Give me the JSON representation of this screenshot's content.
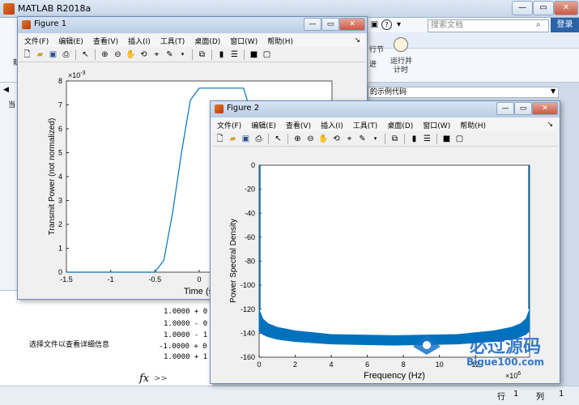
{
  "main_window": {
    "title": "MATLAB R2018a",
    "search_placeholder": "搜索文档",
    "login_label": "登录",
    "ribbon_run_section": "运行并\n计时",
    "ribbon_run_label_1": "运行并",
    "ribbon_run_label_2": "计时",
    "ribbon_section_label": "行节",
    "ribbon_advance_label": "进",
    "ribbon_new_label": "新",
    "example_bar_text": "的示例代码",
    "left_label_1": "当",
    "left_label_2": "详",
    "details_text": "选择文件以查看详细信息",
    "cmd_lines": [
      "1.0000 + 0",
      "1.0000 - 0",
      "1.0000 - 1",
      "-1.0000 + 0",
      "1.0000 + 1"
    ],
    "prompt": ">>",
    "fx": "fx",
    "status": {
      "row_label": "行",
      "row_value": "1",
      "col_label": "列",
      "col_value": "1"
    }
  },
  "menus": [
    "文件(F)",
    "编辑(E)",
    "查看(V)",
    "插入(I)",
    "工具(T)",
    "桌面(D)",
    "窗口(W)",
    "帮助(H)"
  ],
  "figure1": {
    "title": "Figure 1",
    "ylabel": "Transmit Power (not normalized)",
    "xlabel": "Time (s",
    "exponent": "×10",
    "exponent_power": "-3"
  },
  "figure2": {
    "title": "Figure 2",
    "ylabel": "Power Spectral Density",
    "xlabel": "Frequency (Hz)",
    "exponent": "×10",
    "exponent_power": "6"
  },
  "watermark": {
    "line1": "必过源码",
    "line2": "Bigue100.com"
  },
  "chart_data": [
    {
      "type": "line",
      "title": "",
      "xlabel": "Time (s",
      "ylabel": "Transmit Power (not normalized)",
      "xlim": [
        -1.5,
        1.5
      ],
      "ylim": [
        0,
        8
      ],
      "y_scale_exponent": -3,
      "x_ticks": [
        "-1.5",
        "-1",
        "-0.5",
        "0",
        "0.5"
      ],
      "y_ticks": [
        "0",
        "1",
        "2",
        "3",
        "4",
        "5",
        "6",
        "7",
        "8"
      ],
      "series": [
        {
          "x": [
            -1.5,
            -0.5,
            -0.4,
            -0.3,
            -0.2,
            -0.1,
            0.0,
            0.1,
            0.3,
            0.5,
            0.6,
            0.7
          ],
          "y": [
            0,
            0,
            0.5,
            2.5,
            5.0,
            7.2,
            7.7,
            7.7,
            7.7,
            7.7,
            6.5,
            3.0
          ]
        }
      ],
      "color": "#0072bd"
    },
    {
      "type": "area",
      "title": "",
      "xlabel": "Frequency (Hz)",
      "ylabel": "Power Spectral Density",
      "xlim": [
        0,
        15
      ],
      "ylim": [
        -160,
        0
      ],
      "x_scale_exponent": 6,
      "x_ticks": [
        "0",
        "2",
        "4",
        "6",
        "8",
        "10",
        "12"
      ],
      "y_ticks": [
        "0",
        "-20",
        "-40",
        "-60",
        "-80",
        "-100",
        "-120",
        "-140",
        "-160"
      ],
      "series": [
        {
          "name": "upper",
          "x": [
            0,
            0.2,
            0.5,
            1,
            2,
            4,
            7.5,
            11,
            13,
            14,
            14.5,
            14.8,
            15
          ],
          "y": [
            -120,
            -128,
            -132,
            -135,
            -138,
            -141,
            -142,
            -141,
            -138,
            -135,
            -132,
            -128,
            -120
          ]
        },
        {
          "name": "lower",
          "x": [
            0,
            0.2,
            0.5,
            1,
            2,
            4,
            7.5,
            11,
            13,
            14,
            14.5,
            14.8,
            15
          ],
          "y": [
            -138,
            -141,
            -143,
            -145,
            -147,
            -149,
            -150,
            -149,
            -147,
            -145,
            -143,
            -141,
            -138
          ]
        }
      ],
      "spikes": [
        {
          "x": 0,
          "y": 0
        },
        {
          "x": 15,
          "y": 0
        }
      ],
      "color": "#0072bd"
    }
  ]
}
